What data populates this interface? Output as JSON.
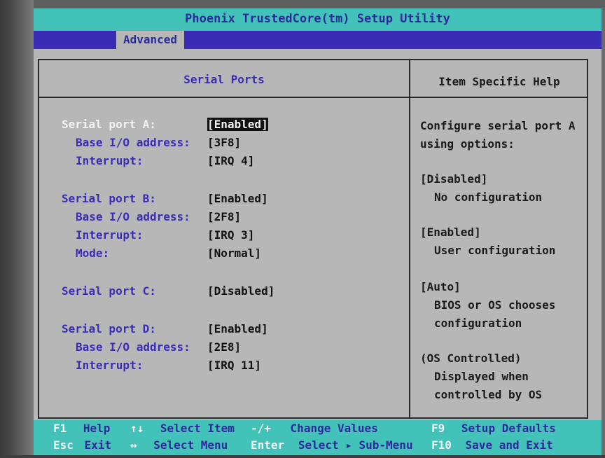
{
  "app": {
    "title": "Phoenix TrustedCore(tm) Setup Utility",
    "active_menu": "Advanced"
  },
  "colors": {
    "title_bg": "#43c2ba",
    "menu_bg": "#3a2cb4",
    "screen_bg": "#b7b7b7",
    "label_text": "#3a2cb4",
    "selected_label": "#f2f2f2"
  },
  "panel": {
    "heading": "Serial Ports",
    "help_heading": "Item Specific Help"
  },
  "settings": [
    {
      "label": "Serial port A:",
      "value": "[Enabled]",
      "selected": true
    },
    {
      "label": "Base I/O address:",
      "value": "[3F8]"
    },
    {
      "label": "Interrupt:",
      "value": "[IRQ 4]"
    },
    {
      "label": "Serial port B:",
      "value": "[Enabled]"
    },
    {
      "label": "Base I/O address:",
      "value": "[2F8]"
    },
    {
      "label": "Interrupt:",
      "value": "[IRQ 3]"
    },
    {
      "label": "Mode:",
      "value": "[Normal]"
    },
    {
      "label": "Serial port C:",
      "value": "[Disabled]"
    },
    {
      "label": "Serial port D:",
      "value": "[Enabled]"
    },
    {
      "label": "Base I/O address:",
      "value": "[2E8]"
    },
    {
      "label": "Interrupt:",
      "value": "[IRQ 11]"
    }
  ],
  "help": [
    "Configure serial port A",
    "using options:",
    "[Disabled]",
    "No configuration",
    "[Enabled]",
    "User configuration",
    "[Auto]",
    "BIOS or OS chooses",
    "configuration",
    "(OS Controlled)",
    "Displayed when",
    "controlled by OS"
  ],
  "footer": {
    "f1_key": "F1",
    "f1_text": "Help",
    "updown_key": "↑↓",
    "updown_text": "Select Item",
    "plusminus_key": "-/+",
    "plusminus_text": "Change Values",
    "f9_key": "F9",
    "f9_text": "Setup Defaults",
    "esc_key": "Esc",
    "esc_text": "Exit",
    "leftright_key": "↔",
    "leftright_text": "Select Menu",
    "enter_key": "Enter",
    "enter_text": "Select ▸ Sub-Menu",
    "f10_key": "F10",
    "f10_text": "Save and Exit"
  }
}
